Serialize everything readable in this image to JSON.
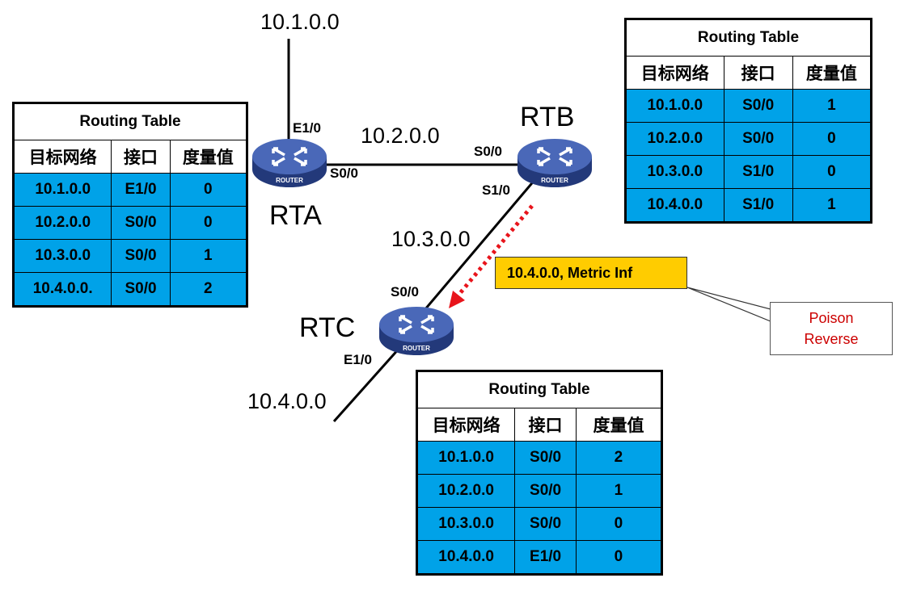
{
  "colors": {
    "table_row": "#00a2e8",
    "router_body": "#3a59a8",
    "callout_bg": "#ffcc00",
    "poison_text": "#cc0000",
    "arrow": "#e8141b"
  },
  "networks": {
    "n1": "10.1.0.0",
    "n2": "10.2.0.0",
    "n3": "10.3.0.0",
    "n4": "10.4.0.0"
  },
  "routers": {
    "rta": {
      "name": "RTA",
      "icon_text": "ROUTER",
      "interfaces": {
        "e1": "E1/0",
        "s0": "S0/0"
      }
    },
    "rtb": {
      "name": "RTB",
      "icon_text": "ROUTER",
      "interfaces": {
        "s0": "S0/0",
        "s1": "S1/0"
      }
    },
    "rtc": {
      "name": "RTC",
      "icon_text": "ROUTER",
      "interfaces": {
        "s0": "S0/0",
        "e1": "E1/0"
      }
    }
  },
  "tables": {
    "rta": {
      "title": "Routing Table",
      "headers": [
        "目标网络",
        "接口",
        "度量值"
      ],
      "rows": [
        [
          "10.1.0.0",
          "E1/0",
          "0"
        ],
        [
          "10.2.0.0",
          "S0/0",
          "0"
        ],
        [
          "10.3.0.0",
          "S0/0",
          "1"
        ],
        [
          "10.4.0.0.",
          "S0/0",
          "2"
        ]
      ]
    },
    "rtb": {
      "title": "Routing Table",
      "headers": [
        "目标网络",
        "接口",
        "度量值"
      ],
      "rows": [
        [
          "10.1.0.0",
          "S0/0",
          "1"
        ],
        [
          "10.2.0.0",
          "S0/0",
          "0"
        ],
        [
          "10.3.0.0",
          "S1/0",
          "0"
        ],
        [
          "10.4.0.0",
          "S1/0",
          "1"
        ]
      ]
    },
    "rtc": {
      "title": "Routing Table",
      "headers": [
        "目标网络",
        "接口",
        "度量值"
      ],
      "rows": [
        [
          "10.1.0.0",
          "S0/0",
          "2"
        ],
        [
          "10.2.0.0",
          "S0/0",
          "1"
        ],
        [
          "10.3.0.0",
          "S0/0",
          "0"
        ],
        [
          "10.4.0.0",
          "E1/0",
          "0"
        ]
      ]
    }
  },
  "update": {
    "text": "10.4.0.0, Metric Inf"
  },
  "note": {
    "line1": "Poison",
    "line2": "Reverse"
  }
}
